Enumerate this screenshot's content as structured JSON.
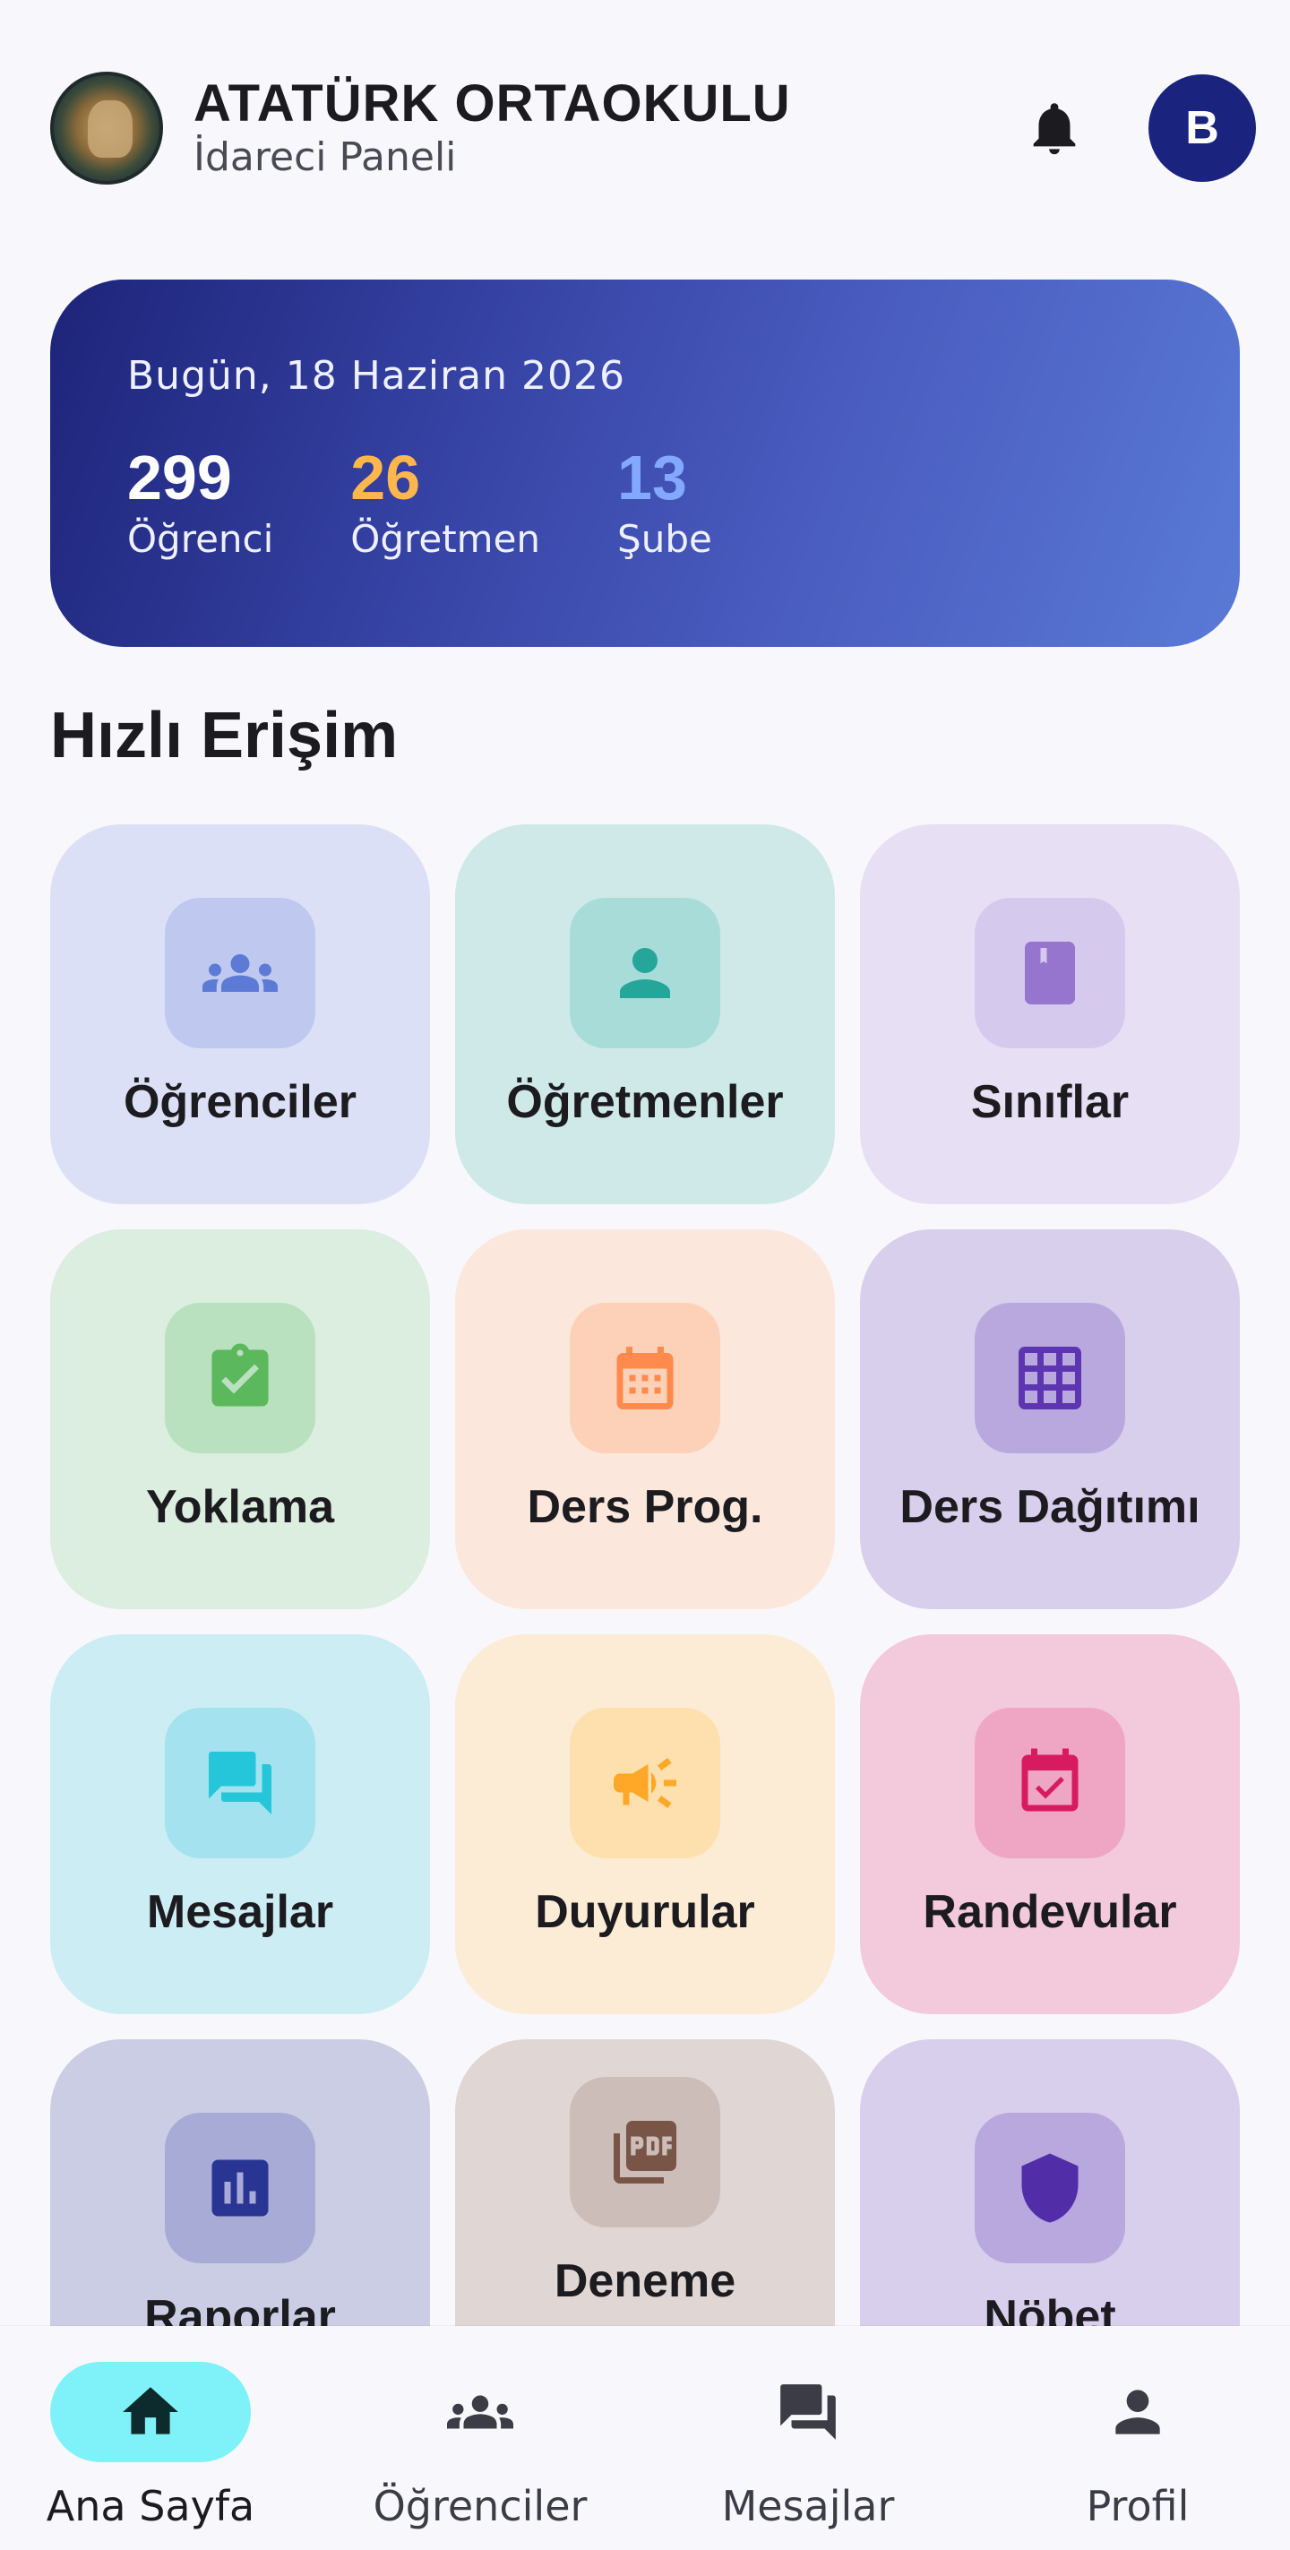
{
  "header": {
    "school_name": "ATATÜRK ORTAOKULU",
    "panel_title": "İdareci Paneli",
    "avatar_initial": "B",
    "logo_icon": "school-seal-logo",
    "notification_icon": "bell-icon"
  },
  "summary": {
    "date_label": "Bugün, 18 Haziran 2026",
    "stats": [
      {
        "value": "299",
        "label": "Öğrenci",
        "color": "#ffffff"
      },
      {
        "value": "26",
        "label": "Öğretmen",
        "color": "#ffb74d"
      },
      {
        "value": "13",
        "label": "Şube",
        "color": "#82a8ff"
      }
    ]
  },
  "quick_access": {
    "title": "Hızlı Erişim",
    "tiles": [
      {
        "label": "Öğrenciler",
        "icon": "group-icon",
        "bg": "#dbe0f7",
        "icon_bg": "#bfc9ef",
        "icon_color": "#5c7ad6"
      },
      {
        "label": "Öğretmenler",
        "icon": "person-icon",
        "bg": "#cfe9e8",
        "icon_bg": "#a8dcd8",
        "icon_color": "#26a69a"
      },
      {
        "label": "Sınıflar",
        "icon": "book-icon",
        "bg": "#e7e0f4",
        "icon_bg": "#d6c9ee",
        "icon_color": "#9575cd"
      },
      {
        "label": "Yoklama",
        "icon": "clipboard-check-icon",
        "bg": "#dbeedf",
        "icon_bg": "#b9e0bf",
        "icon_color": "#5cb85c"
      },
      {
        "label": "Ders Prog.",
        "icon": "calendar-icon",
        "bg": "#fce7dc",
        "icon_bg": "#fdd1b7",
        "icon_color": "#ff8a4d"
      },
      {
        "label": "Ders Dağıtımı",
        "icon": "grid-icon",
        "bg": "#d8cfec",
        "icon_bg": "#b9a8dd",
        "icon_color": "#5e35b1"
      },
      {
        "label": "Mesajlar",
        "icon": "forum-icon",
        "bg": "#cdedf5",
        "icon_bg": "#a3e2ee",
        "icon_color": "#26c6da"
      },
      {
        "label": "Duyurular",
        "icon": "campaign-icon",
        "bg": "#fcecd6",
        "icon_bg": "#fde0ad",
        "icon_color": "#ffa726"
      },
      {
        "label": "Randevular",
        "icon": "event-check-icon",
        "bg": "#f3c9dc",
        "icon_bg": "#eea6c4",
        "icon_color": "#d81b60"
      },
      {
        "label": "Raporlar",
        "icon": "bar-chart-icon",
        "bg": "#cacde4",
        "icon_bg": "#a7abd5",
        "icon_color": "#283593"
      },
      {
        "label": "Deneme",
        "icon": "pdf-icon",
        "bg": "#e0d6d4",
        "icon_bg": "#cdbdb8",
        "icon_color": "#795548"
      },
      {
        "label": "Nöbet",
        "icon": "shield-icon",
        "bg": "#d8cfec",
        "icon_bg": "#b9a8dd",
        "icon_color": "#512da8"
      }
    ]
  },
  "bottom_nav": [
    {
      "label": "Ana Sayfa",
      "icon": "home-icon",
      "active": true
    },
    {
      "label": "Öğrenciler",
      "icon": "group-icon",
      "active": false
    },
    {
      "label": "Mesajlar",
      "icon": "forum-icon",
      "active": false
    },
    {
      "label": "Profil",
      "icon": "person-icon",
      "active": false
    }
  ]
}
